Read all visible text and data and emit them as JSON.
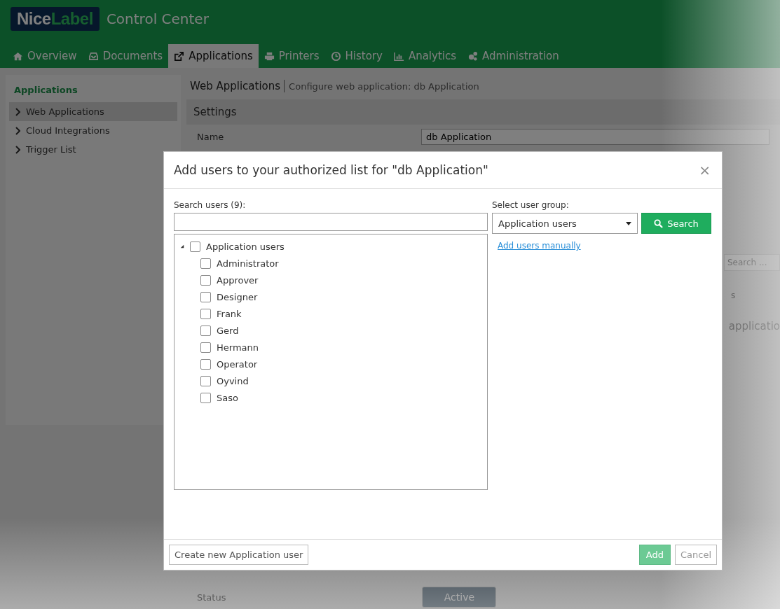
{
  "app": {
    "logo": {
      "lead": "Nice",
      "accent": "Label"
    },
    "title": "Control Center"
  },
  "tabs": [
    {
      "label": "Overview",
      "kind": "home",
      "selected": false
    },
    {
      "label": "Documents",
      "kind": "inbox",
      "selected": false
    },
    {
      "label": "Applications",
      "kind": "share",
      "selected": true
    },
    {
      "label": "Printers",
      "kind": "printer",
      "selected": false
    },
    {
      "label": "History",
      "kind": "clock",
      "selected": false
    },
    {
      "label": "Analytics",
      "kind": "chart",
      "selected": false
    },
    {
      "label": "Administration",
      "kind": "gears",
      "selected": false
    }
  ],
  "sidebar": {
    "title": "Applications",
    "items": [
      {
        "label": "Web Applications",
        "selected": true
      },
      {
        "label": "Cloud Integrations",
        "selected": false
      },
      {
        "label": "Trigger List",
        "selected": false
      }
    ]
  },
  "breadcrumb": {
    "current": "Web Applications",
    "detail": "Configure web application: db Application"
  },
  "settings": {
    "title": "Settings",
    "name_label": "Name",
    "name_value": "db Application",
    "search_placeholder": "Search ...",
    "fragment": "s",
    "empty_text": "applicatio",
    "status_label": "Status",
    "status_value": "Active"
  },
  "dialog": {
    "title": "Add users to your authorized list for \"db Application\"",
    "close": "×",
    "search_label": "Search users (9):",
    "group_label": "Select user group:",
    "group_value": "Application users",
    "search_button": "Search",
    "manual_link": "Add users manually",
    "tree": [
      {
        "label": "Application users",
        "checked": false,
        "expanded": true,
        "children": [
          {
            "label": "Administrator",
            "checked": false
          },
          {
            "label": "Approver",
            "checked": false
          },
          {
            "label": "Designer",
            "checked": false
          },
          {
            "label": "Frank",
            "checked": false
          },
          {
            "label": "Gerd",
            "checked": false
          },
          {
            "label": "Hermann",
            "checked": false
          },
          {
            "label": "Operator",
            "checked": false
          },
          {
            "label": "Oyvind",
            "checked": false
          },
          {
            "label": "Saso",
            "checked": false
          }
        ]
      }
    ],
    "create_button": "Create new Application user",
    "add_button": "Add",
    "cancel_button": "Cancel"
  }
}
